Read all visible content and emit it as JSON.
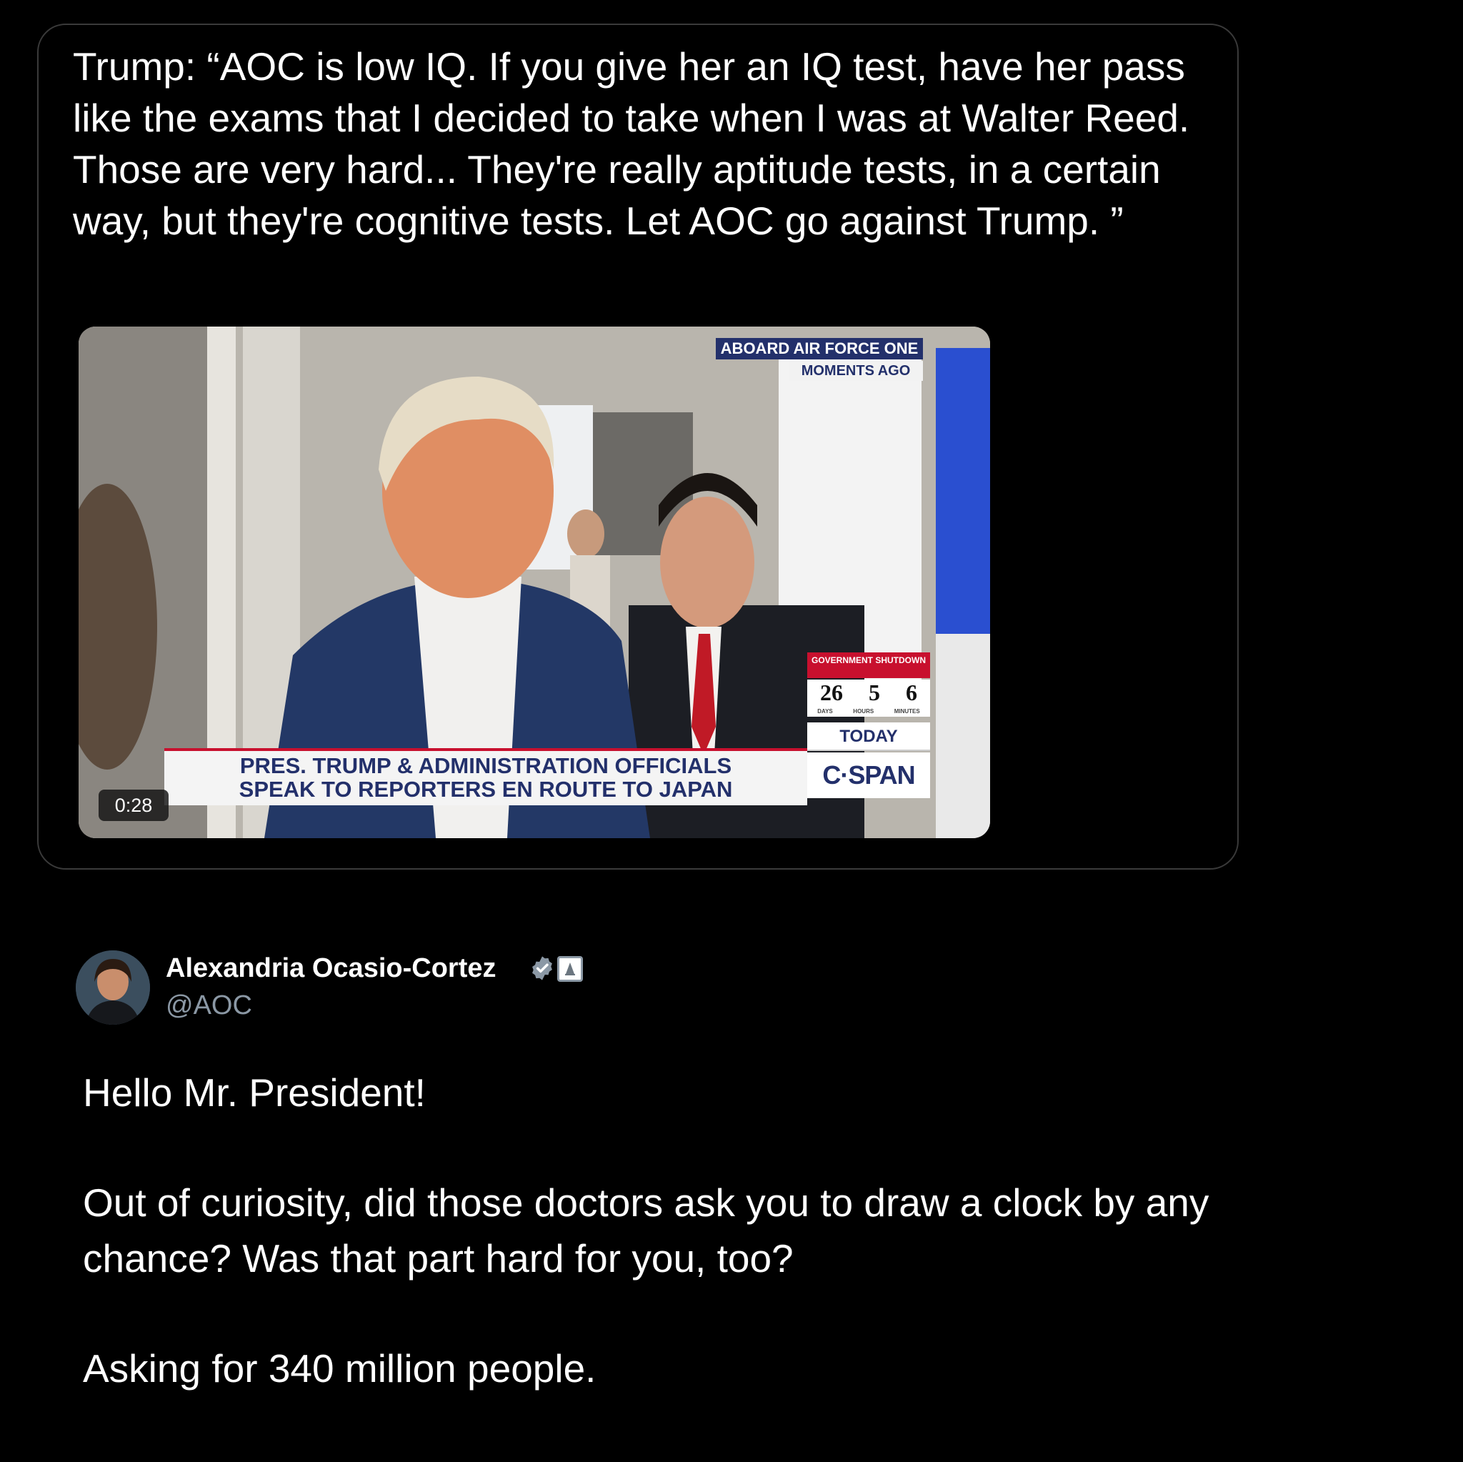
{
  "quoted_post": {
    "text": "Trump: “AOC is low IQ. If you give her an IQ test, have her pass like the exams that I decided to take when I was at Walter Reed. Those are very hard... They're really aptitude tests, in a certain way, but they're cognitive tests. Let AOC go against Trump. ”",
    "video": {
      "duration": "0:28",
      "location_banner": "ABOARD AIR FORCE ONE",
      "time_banner": "MOMENTS AGO",
      "lower_third_line1": "PRES. TRUMP & ADMINISTRATION OFFICIALS",
      "lower_third_line2": "SPEAK TO REPORTERS EN ROUTE TO JAPAN",
      "shutdown_label": "GOVERNMENT SHUTDOWN",
      "shutdown_days": "26",
      "shutdown_hours": "5",
      "shutdown_minutes": "6",
      "unit_days": "DAYS",
      "unit_hours": "HOURS",
      "unit_minutes": "MINUTES",
      "today_label": "TODAY",
      "network": "C·SPAN"
    }
  },
  "reply": {
    "author_name": "Alexandria Ocasio-Cortez",
    "handle": "@AOC",
    "verified_color": "#8b98a5",
    "line1": "Hello Mr. President!",
    "line2": "Out of curiosity, did those doctors ask you to draw a clock by any chance? Was that part hard for you, too?",
    "line3": "Asking for 340 million people."
  }
}
